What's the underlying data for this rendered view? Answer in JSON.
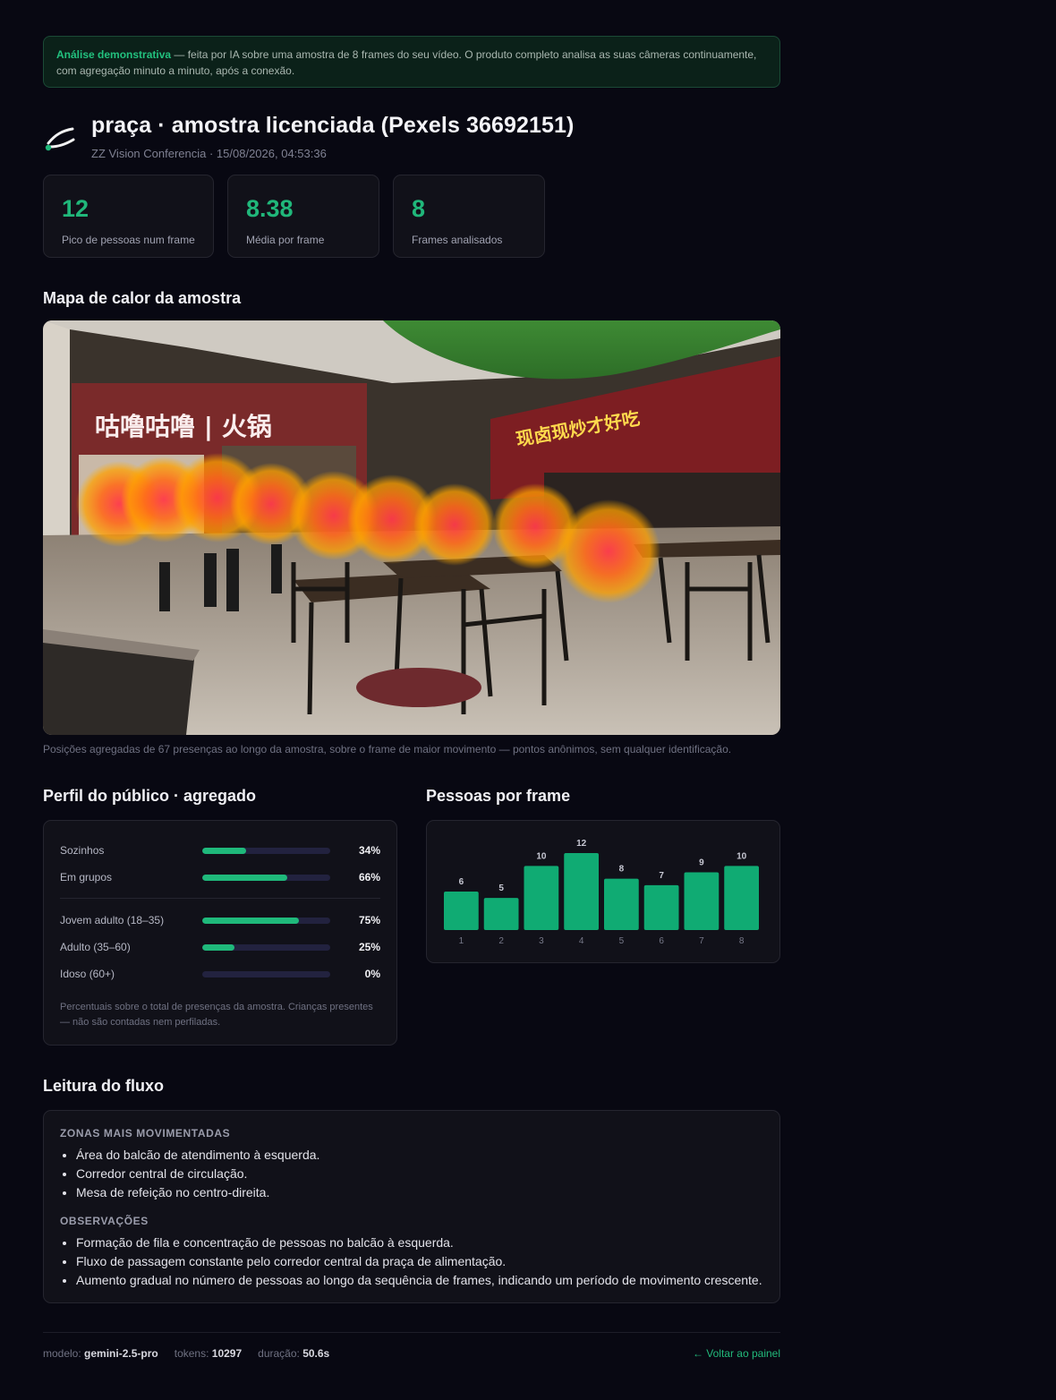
{
  "banner": {
    "highlight": "Análise demonstrativa",
    "text": " — feita por IA sobre uma amostra de 8 frames do seu vídeo. O produto completo analisa as suas câmeras continuamente, com agregação minuto a minuto, após a conexão."
  },
  "header": {
    "title": "praça · amostra licenciada (Pexels 36692151)",
    "subtitle": "ZZ Vision Conferencia · 15/08/2026, 04:53:36"
  },
  "stats": [
    {
      "value": "12",
      "label": "Pico de pessoas num frame"
    },
    {
      "value": "8.38",
      "label": "Média por frame"
    },
    {
      "value": "8",
      "label": "Frames analisados"
    }
  ],
  "heatmap": {
    "title": "Mapa de calor da amostra",
    "caption": "Posições agregadas de 67 presenças ao longo da amostra, sobre o frame de maior movimento — pontos anônimos, sem qualquer identificação.",
    "sign_left": "咕噜咕噜 | 火锅",
    "sign_right": "现卤现炒才好吃"
  },
  "profile": {
    "title": "Perfil do público · agregado",
    "group1": [
      {
        "label": "Sozinhos",
        "value": "34%",
        "pct": 34
      },
      {
        "label": "Em grupos",
        "value": "66%",
        "pct": 66
      }
    ],
    "group2": [
      {
        "label": "Jovem adulto (18–35)",
        "value": "75%",
        "pct": 75
      },
      {
        "label": "Adulto (35–60)",
        "value": "25%",
        "pct": 25
      },
      {
        "label": "Idoso (60+)",
        "value": "0%",
        "pct": 0
      }
    ],
    "note": "Percentuais sobre o total de presenças da amostra. Crianças presentes — não são contadas nem perfiladas."
  },
  "chart_data": {
    "type": "bar",
    "title": "Pessoas por frame",
    "categories": [
      "1",
      "2",
      "3",
      "4",
      "5",
      "6",
      "7",
      "8"
    ],
    "values": [
      6,
      5,
      10,
      12,
      8,
      7,
      9,
      10
    ],
    "color": "#10ab73"
  },
  "flow": {
    "title": "Leitura do fluxo",
    "zones_title": "ZONAS MAIS MOVIMENTADAS",
    "zones": [
      "Área do balcão de atendimento à esquerda.",
      "Corredor central de circulação.",
      "Mesa de refeição no centro-direita."
    ],
    "obs_title": "OBSERVAÇÕES",
    "observations": [
      "Formação de fila e concentração de pessoas no balcão à esquerda.",
      "Fluxo de passagem constante pelo corredor central da praça de alimentação.",
      "Aumento gradual no número de pessoas ao longo da sequência de frames, indicando um período de movimento crescente."
    ]
  },
  "footer": {
    "model_label": "modelo:",
    "model": "gemini-2.5-pro",
    "tokens_label": "tokens:",
    "tokens": "10297",
    "duration_label": "duração:",
    "duration": "50.6s",
    "back": "← Voltar ao painel"
  },
  "colors": {
    "accent": "#20b77a",
    "banner_bg": "#0b2119",
    "card_bg": "#111119",
    "page_bg": "#080812"
  }
}
